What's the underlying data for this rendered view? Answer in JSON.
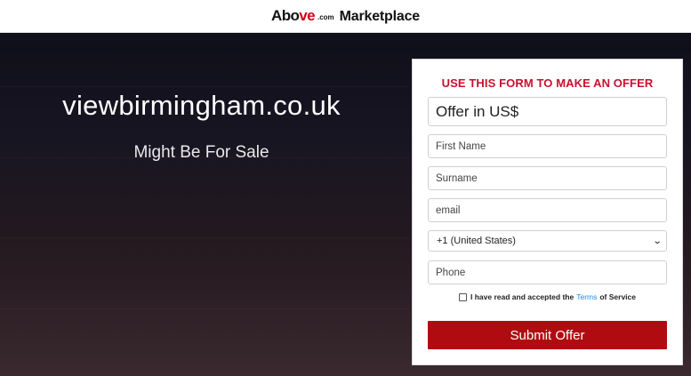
{
  "header": {
    "logo_brand_left": "Abo",
    "logo_brand_ve": "ve",
    "logo_dotcom": ".com",
    "logo_marketplace": "Marketplace"
  },
  "hero": {
    "domain": "viewbirmingham.co.uk",
    "tagline": "Might Be For Sale"
  },
  "form": {
    "title": "USE THIS FORM TO MAKE AN OFFER",
    "offer_placeholder": "Offer in US$",
    "first_name_placeholder": "First Name",
    "surname_placeholder": "Surname",
    "email_placeholder": "email",
    "country_code_selected": "+1 (United States)",
    "phone_placeholder": "Phone",
    "terms_prefix": "I have read and accepted the",
    "terms_link": "Terms",
    "terms_suffix": "of Service",
    "submit_label": "Submit Offer"
  },
  "colors": {
    "accent_red": "#c8102e",
    "button_red": "#b10b12",
    "link_blue": "#1e88e5"
  },
  "icons": {
    "select_chevron": "chevron-down-icon"
  }
}
